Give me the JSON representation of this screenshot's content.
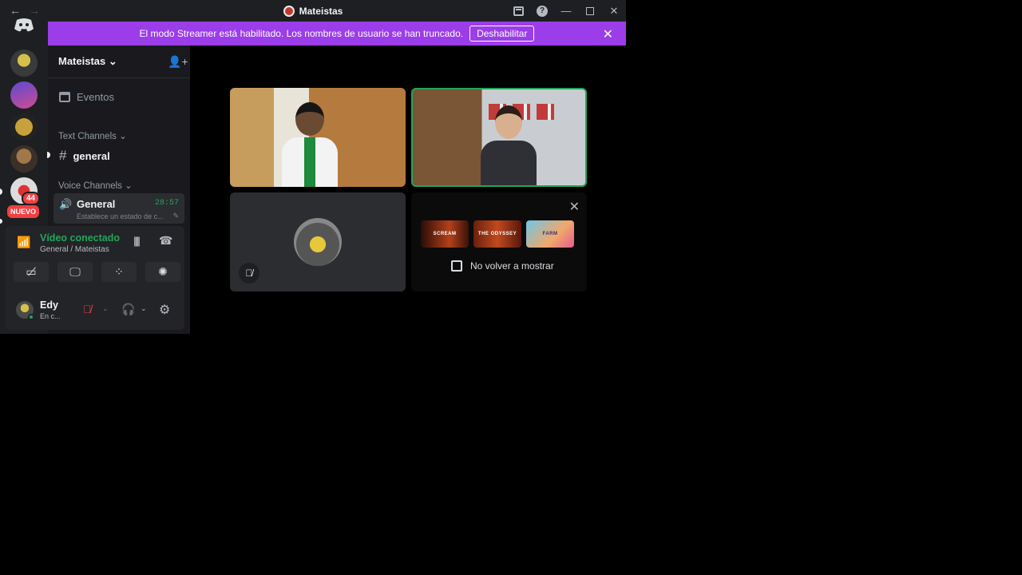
{
  "titlebar": {
    "title": "Mateistas",
    "back_icon": "←",
    "forward_icon": "→",
    "minimize": "—",
    "close": "✕"
  },
  "rail": {
    "badge_count": "44",
    "new_label": "NUEVO"
  },
  "banner": {
    "message": "El modo Streamer está habilitado. Los nombres de usuario se han truncado.",
    "button": "Deshabilitar",
    "close": "✕"
  },
  "sidebar": {
    "guild_name": "Mateistas",
    "events": "Eventos",
    "text_category": "Text Channels",
    "text_channel": "general",
    "voice_category": "Voice Channels",
    "voice_channel": {
      "name": "General",
      "timer": "28:57",
      "status_placeholder": "Establece un estado de c..."
    }
  },
  "rtc": {
    "title": "Vídeo conectado",
    "subtitle": "General / Mateistas"
  },
  "user": {
    "name": "Edy",
    "status": "En c..."
  },
  "promo": {
    "games": [
      "SCREAM",
      "THE ODYSSEY",
      "FARM"
    ],
    "dont_show": "No volver a mostrar"
  },
  "colors": {
    "banner": "#9b3de8",
    "connected": "#23a55a",
    "danger": "#f23f43"
  }
}
